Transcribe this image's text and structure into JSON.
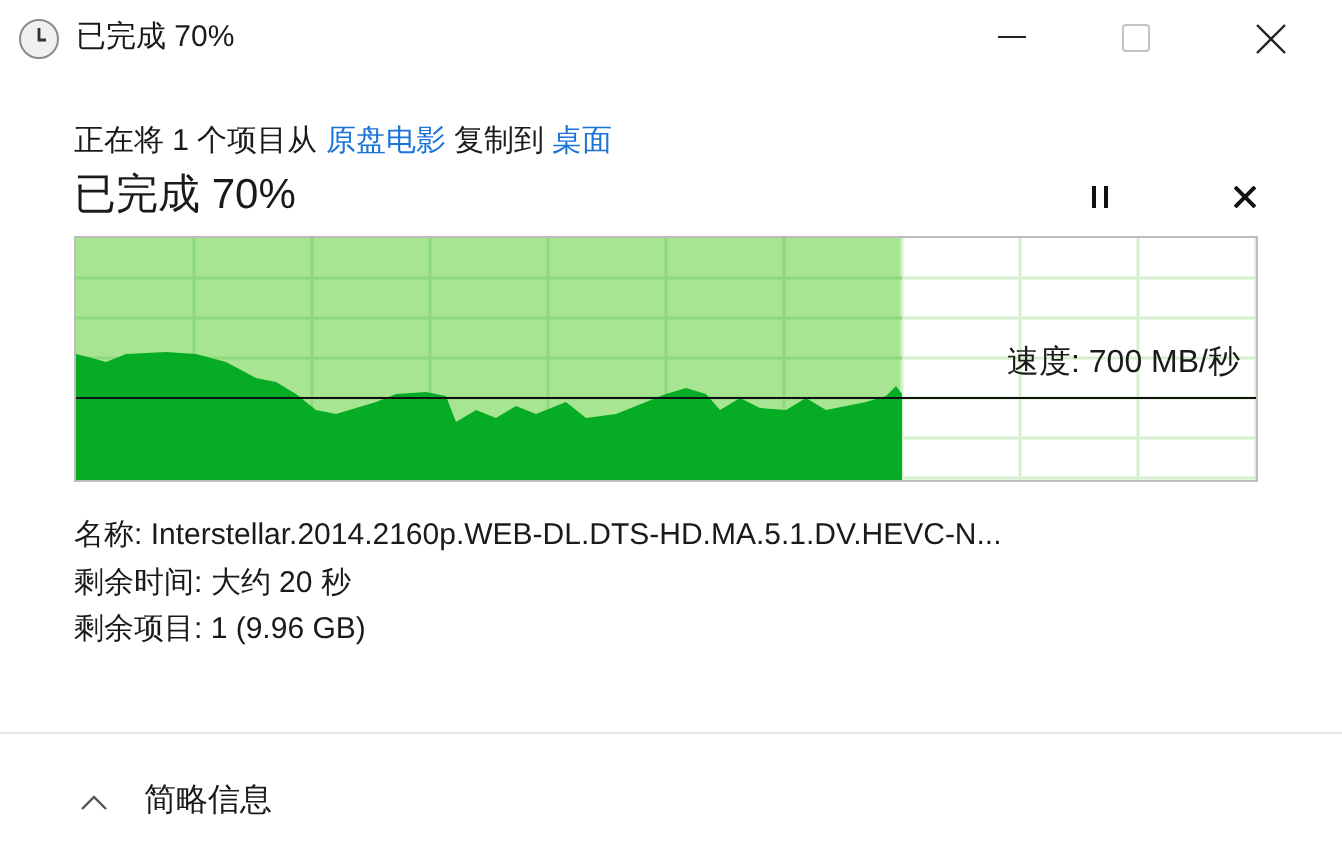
{
  "window": {
    "title": "已完成 70%"
  },
  "status": {
    "prefix": "正在将 1 个项目从",
    "source": "原盘电影",
    "middle": "复制到",
    "destination": "桌面"
  },
  "heading": "已完成 70%",
  "progress": {
    "level": 0.7,
    "speed": "速度: 700 MB/秒"
  },
  "details": [
    "名称: Interstellar.2014.2160p.WEB-DL.DTS-HD.MA.5.1.DV.HEVC-N...",
    "剩余时间: 大约 20 秒",
    "剩余项目: 1 (9.96 GB)"
  ],
  "footer": {
    "label": "简略信息",
    "expanded": true
  }
}
